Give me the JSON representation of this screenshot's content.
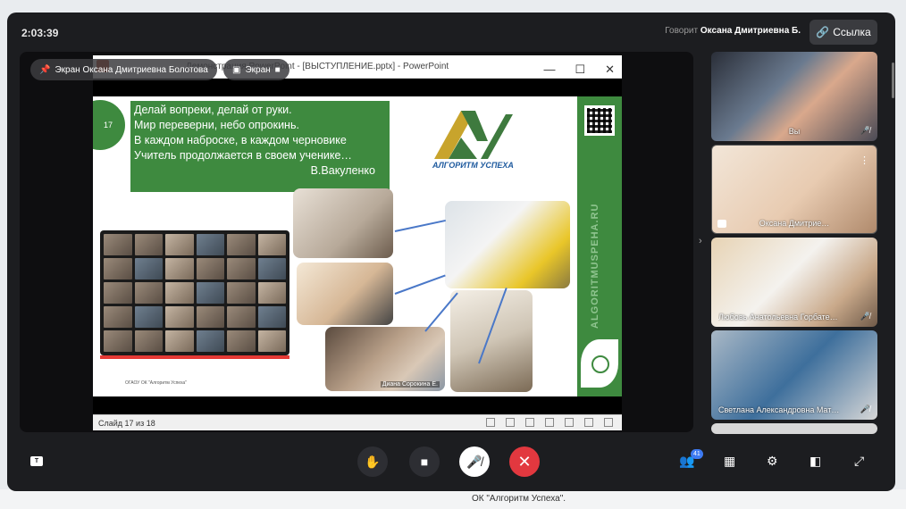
{
  "call": {
    "timer": "2:03:39",
    "speaking_prefix": "Говорит",
    "speaking_name": "Оксана Дмитриевна Б.",
    "link_label": "Ссылка"
  },
  "overlay": {
    "screen_owner": "Экран Оксана Дмитриевна Болотова",
    "screen_label": "Экран"
  },
  "ppt": {
    "window_title": "Демонстрация PowerPoint - [ВЫСТУПЛЕНИЕ.pptx] - PowerPoint",
    "status": "Слайд 17 из 18"
  },
  "slide": {
    "number": "17",
    "quote_lines": [
      "Делай вопреки, делай от руки.",
      "Мир переверни, небо опрокинь.",
      "В каждом наброске, в каждом черновике",
      "Учитель продолжается в своем ученике…"
    ],
    "author": "В.Вакуленко",
    "logo_text": "АЛГОРИТМ УСПЕХА",
    "vertical_text": "ALGORITMUSPEHA.RU",
    "photo_name": "Диана Сорокина Е.",
    "footnote": "ОГАОУ ОК \"Алгоритм Успеха\""
  },
  "participants": [
    {
      "name": "Вы",
      "muted": true
    },
    {
      "name": "Оксана Дмитрие…",
      "muted": false
    },
    {
      "name": "Любовь Анатольевна Горбате…",
      "muted": true
    },
    {
      "name": "Светлана Александровна Мат…",
      "muted": true
    }
  ],
  "controls": {
    "participants_count": "41"
  },
  "background": {
    "footer_text": "ОК \"Алгоритм Успеха\"."
  },
  "colors": {
    "slide_green": "#3e8a3f",
    "end_call": "#e2383f",
    "accent_blue": "#3d7af2"
  }
}
